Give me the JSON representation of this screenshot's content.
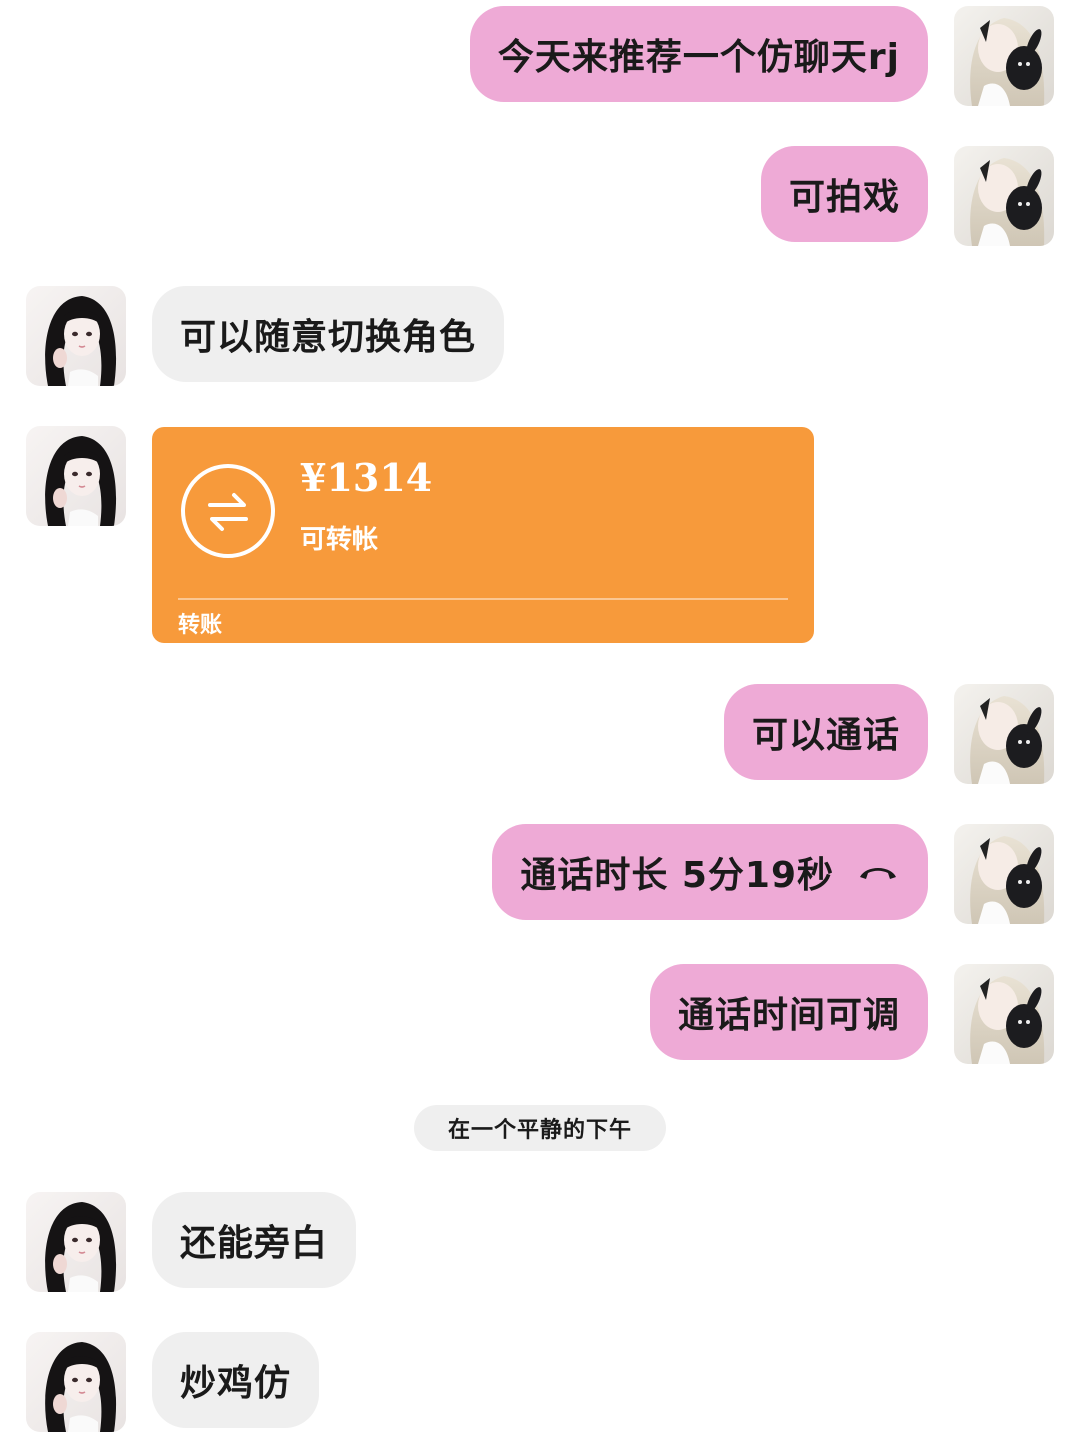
{
  "messages": [
    {
      "sender": "me",
      "text": "今天来推荐一个仿聊天rj"
    },
    {
      "sender": "me",
      "text": "可拍戏"
    },
    {
      "sender": "them",
      "text": "可以随意切换角色"
    },
    {
      "sender": "them",
      "type": "transfer",
      "amount": "¥1314",
      "note": "可转帐",
      "footer": "转账"
    },
    {
      "sender": "me",
      "text": "可以通话"
    },
    {
      "sender": "me",
      "type": "call",
      "text": "通话时长 5分19秒",
      "icon": "phone-hangup-icon"
    },
    {
      "sender": "me",
      "text": "通话时间可调"
    },
    {
      "type": "narration",
      "text": "在一个平静的下午"
    },
    {
      "sender": "them",
      "text": "还能旁白"
    },
    {
      "sender": "them",
      "text": "炒鸡仿"
    }
  ],
  "colors": {
    "me_bubble": "#eeaad6",
    "them_bubble": "#efefef",
    "transfer_card": "#f79a3b"
  }
}
